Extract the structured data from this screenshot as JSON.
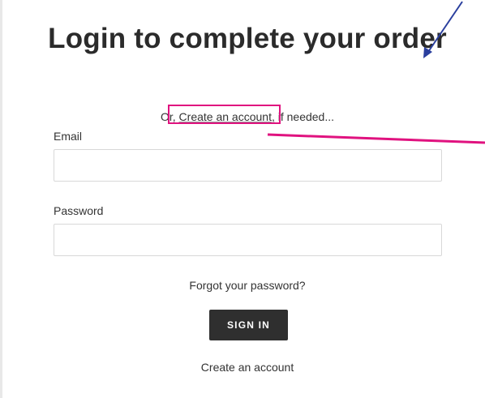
{
  "form": {
    "title": "Login to complete your order",
    "sub_prefix": "Or,",
    "sub_link": "Create an account,",
    "sub_suffix": "if needed...",
    "email_label": "Email",
    "email_value": "",
    "password_label": "Password",
    "password_value": "",
    "forgot_label": "Forgot your password?",
    "signin_label": "SIGN IN",
    "create_account_label": "Create an account"
  },
  "annotations": {
    "highlight_color": "#e0127f",
    "arrow_color": "#2a3f9e"
  }
}
